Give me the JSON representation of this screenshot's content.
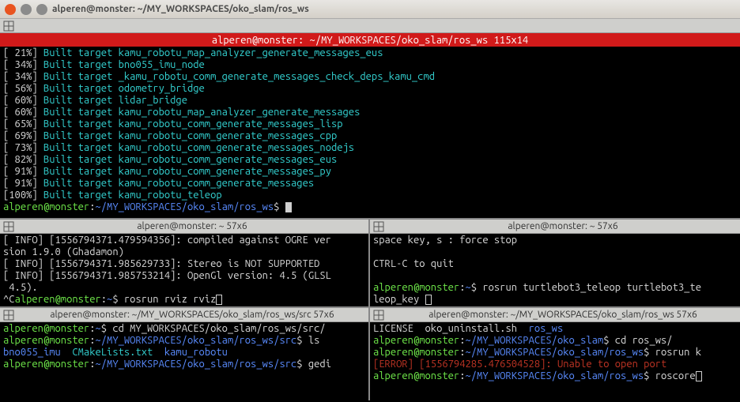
{
  "window_title": "alperen@monster: ~/MY_WORKSPACES/oko_slam/ros_ws",
  "top_pane": {
    "header_red": "alperen@monster: ~/MY_WORKSPACES/oko_slam/ros_ws 115x14",
    "build_lines": [
      {
        "pct": "[ 21%]",
        "text": " Built target kamu_robotu_map_analyzer_generate_messages_eus"
      },
      {
        "pct": "[ 34%]",
        "text": " Built target bno055_imu_node"
      },
      {
        "pct": "[ 34%]",
        "text": " Built target _kamu_robotu_comm_generate_messages_check_deps_kamu_cmd"
      },
      {
        "pct": "[ 56%]",
        "text": " Built target odometry_bridge"
      },
      {
        "pct": "[ 60%]",
        "text": " Built target lidar_bridge"
      },
      {
        "pct": "[ 60%]",
        "text": " Built target kamu_robotu_map_analyzer_generate_messages"
      },
      {
        "pct": "[ 65%]",
        "text": " Built target kamu_robotu_comm_generate_messages_lisp"
      },
      {
        "pct": "[ 69%]",
        "text": " Built target kamu_robotu_comm_generate_messages_cpp"
      },
      {
        "pct": "[ 73%]",
        "text": " Built target kamu_robotu_comm_generate_messages_nodejs"
      },
      {
        "pct": "[ 82%]",
        "text": " Built target kamu_robotu_comm_generate_messages_eus"
      },
      {
        "pct": "[ 91%]",
        "text": " Built target kamu_robotu_comm_generate_messages_py"
      },
      {
        "pct": "[ 91%]",
        "text": " Built target kamu_robotu_comm_generate_messages"
      },
      {
        "pct": "[100%]",
        "text": " Built target kamu_robotu_teleop"
      }
    ],
    "prompt_user": "alperen@monster",
    "prompt_path": "~/MY_WORKSPACES/oko_slam/ros_ws",
    "prompt_symbol": "$ "
  },
  "mid_left": {
    "title": "alperen@monster: ~ 57x6",
    "l1": "[ INFO] [1556794371.479594356]: compiled against OGRE ver",
    "l2": "sion 1.9.0 (Ghadamon)",
    "l3": "[ INFO] [1556794371.985629733]: Stereo is NOT SUPPORTED",
    "l4": "[ INFO] [1556794371.985753214]: OpenGl version: 4.5 (GLSL",
    "l5": " 4.5).",
    "caret": "^C",
    "prompt_user": "alperen@monster",
    "prompt_path": "~",
    "cmd": "rosrun rviz rviz"
  },
  "mid_right": {
    "title": "alperen@monster: ~ 57x6",
    "l1": "space key, s : force stop",
    "l2": "",
    "l3": "CTRL-C to quit",
    "l4": "",
    "prompt_user": "alperen@monster",
    "prompt_path": "~",
    "cmd": "rosrun turtlebot3_teleop turtlebot3_te",
    "cont": "leop_key "
  },
  "bot_left": {
    "title": "alperen@monster: ~/MY_WORKSPACES/oko_slam/ros_ws/src 57x6",
    "p1_user": "alperen@monster",
    "p1_path": "~",
    "p1_cmd": "cd MY_WORKSPACES/oko_slam/ros_ws/src/",
    "p2_user": "alperen@monster",
    "p2_path": "~/MY_WORKSPACES/oko_slam/ros_ws/src",
    "p2_cmd": "ls",
    "ls_dir1": "bno055_imu",
    "ls_file": "  CMakeLists.txt  ",
    "ls_dir2": "kamu_robotu",
    "p3_user": "alperen@monster",
    "p3_path": "~/MY_WORKSPACES/oko_slam/ros_ws/src",
    "p3_cmd": "gedi"
  },
  "bot_right": {
    "title": "alperen@monster: ~/MY_WORKSPACES/oko_slam/ros_ws 57x6",
    "ls_line_a": "LICENSE  oko_uninstall.sh  ",
    "ls_dir": "ros_ws",
    "p1_user": "alperen@monster",
    "p1_path": "~/MY_WORKSPACES/oko_slam",
    "p1_cmd": "cd ros_ws/",
    "p2_user": "alperen@monster",
    "p2_path": "~/MY_WORKSPACES/oko_slam/ros_ws",
    "p2_cmd": "rosrun k",
    "err": "[ERROR] [1556794285.476504528]: Unable to open port",
    "p3_user": "alperen@monster",
    "p3_path": "~/MY_WORKSPACES/oko_slam/ros_ws",
    "p3_cmd": "roscore"
  }
}
